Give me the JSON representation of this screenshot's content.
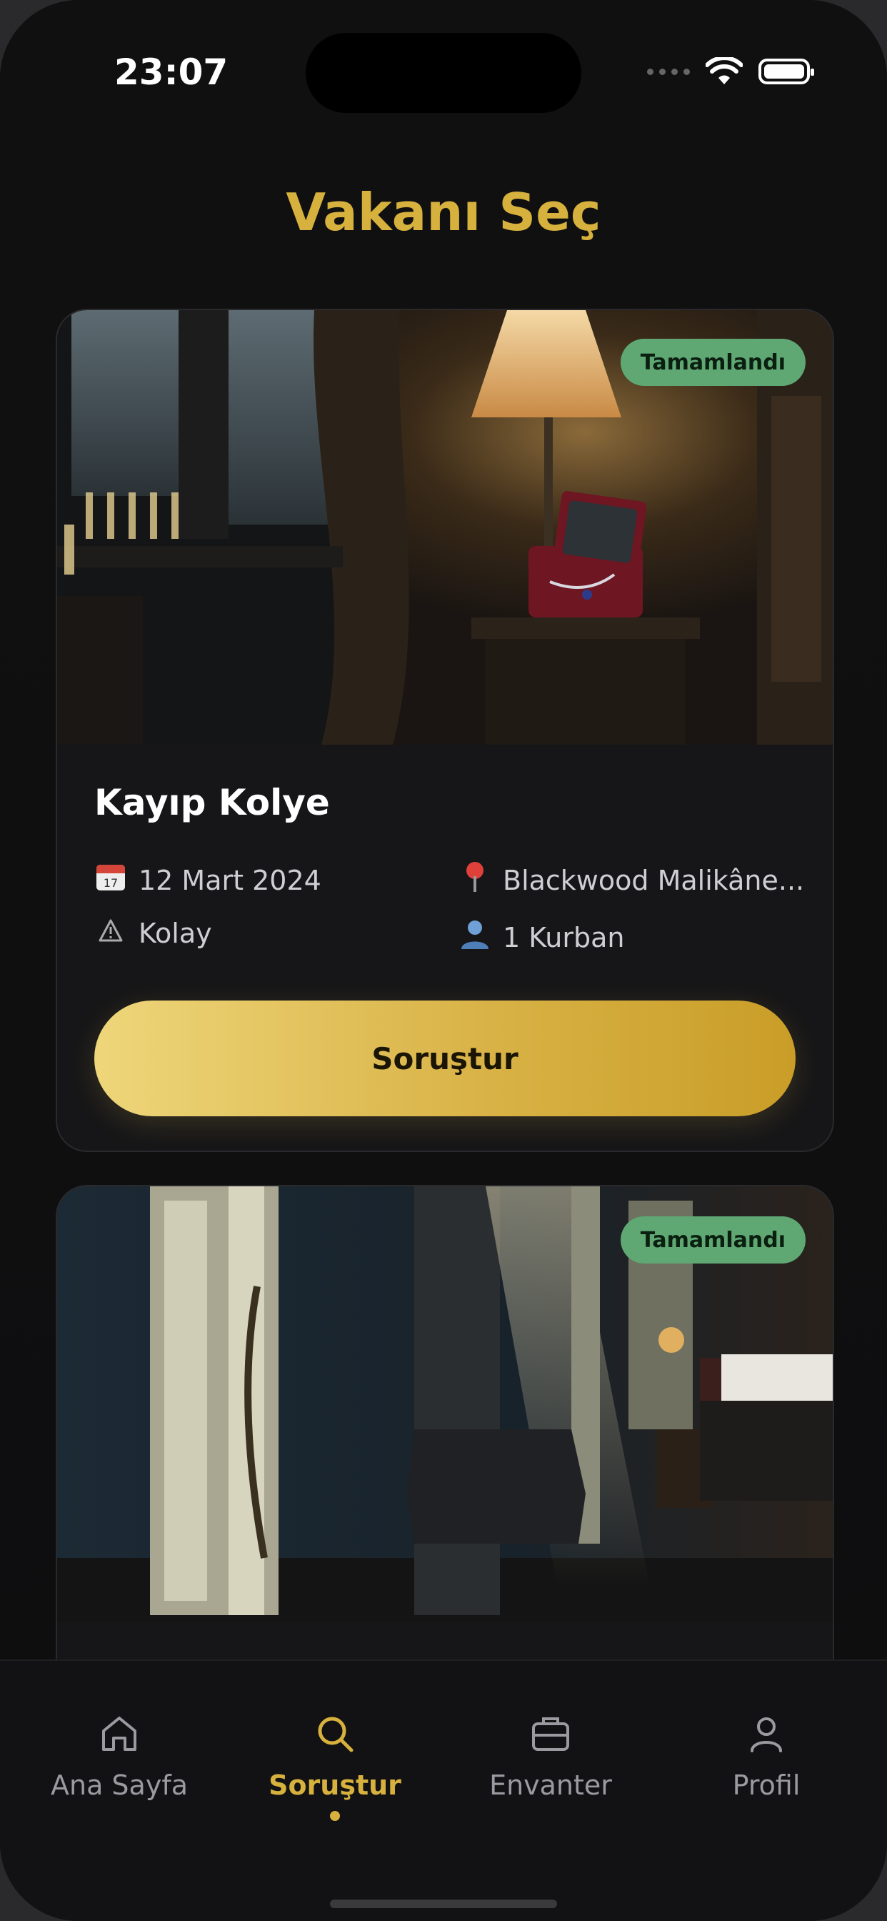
{
  "status": {
    "time": "23:07"
  },
  "page": {
    "title": "Vakanı Seç"
  },
  "cases": [
    {
      "badge": "Tamamlandı",
      "title": "Kayıp Kolye",
      "date": "12 Mart 2024",
      "location": "Blackwood Malikâne...",
      "difficulty": "Kolay",
      "victims": "1 Kurban",
      "cta": "Soruştur"
    },
    {
      "badge": "Tamamlandı"
    }
  ],
  "icons": {
    "date": "calendar-icon",
    "location": "pin-icon",
    "difficulty": "warning-icon",
    "victims": "person-icon"
  },
  "tabs": [
    {
      "label": "Ana Sayfa",
      "icon": "home-icon"
    },
    {
      "label": "Soruştur",
      "icon": "search-icon",
      "active": true
    },
    {
      "label": "Envanter",
      "icon": "briefcase-icon"
    },
    {
      "label": "Profil",
      "icon": "user-icon"
    }
  ],
  "colors": {
    "accent": "#d7b13d",
    "badge": "#5fa874",
    "background": "#0e0e0f"
  }
}
